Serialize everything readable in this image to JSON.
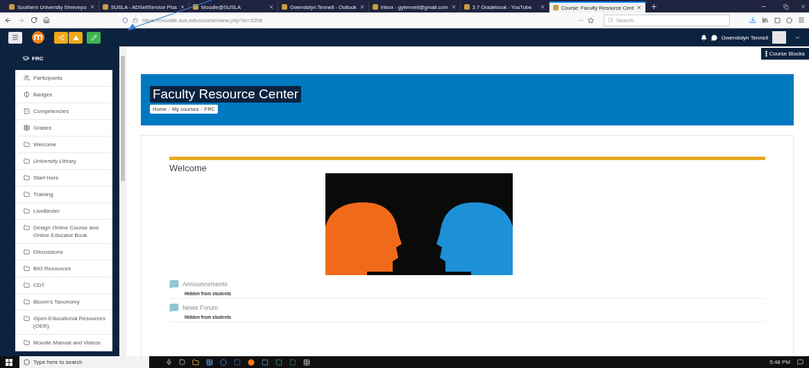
{
  "browser_tabs": [
    {
      "title": "Southern University Shrevepo",
      "selected": false
    },
    {
      "title": "SUSLA - ADSelfService Plus",
      "selected": false
    },
    {
      "title": "Moodle@SUSLA",
      "selected": false
    },
    {
      "title": "Gwendolyn Tennell - Outlook",
      "selected": false
    },
    {
      "title": "Inbox - gytennell@gmail.com",
      "selected": false
    },
    {
      "title": "3 7 Gradebook - YouTube",
      "selected": false
    },
    {
      "title": "Course: Faculty Resource Cent",
      "selected": true
    }
  ],
  "address_bar": {
    "url": "https://moodle.sus.edu/course/view.php?id=3208",
    "more": "···",
    "search_placeholder": "Search"
  },
  "navbar": {
    "user_name": "Gwendolyn Tennell",
    "course_blocks_button": "Course Blocks"
  },
  "sidebar": {
    "title": "FRC",
    "items": [
      {
        "label": "Participants",
        "kind": "people"
      },
      {
        "label": "Badges",
        "kind": "shield"
      },
      {
        "label": "Competencies",
        "kind": "check"
      },
      {
        "label": "Grades",
        "kind": "table"
      },
      {
        "label": "Welcome",
        "kind": "folder"
      },
      {
        "label": "University Library",
        "kind": "folder"
      },
      {
        "label": "Start Here",
        "kind": "folder"
      },
      {
        "label": "Training",
        "kind": "folder"
      },
      {
        "label": "LiveBinder",
        "kind": "folder"
      },
      {
        "label": "Design Online Course and Online Educator Book",
        "kind": "folder"
      },
      {
        "label": "Discussions",
        "kind": "folder"
      },
      {
        "label": "BIO Resources",
        "kind": "folder"
      },
      {
        "label": "CDT",
        "kind": "folder"
      },
      {
        "label": "Bloom's Taxonomy",
        "kind": "folder"
      },
      {
        "label": "Open Educational Resources (OER)",
        "kind": "folder"
      },
      {
        "label": "Moodle Manual and Videos",
        "kind": "folder"
      }
    ]
  },
  "page_header": {
    "title": "Faculty Resource Center",
    "breadcrumb": [
      "Home",
      "My courses",
      "FRC"
    ],
    "separator": "/"
  },
  "section": {
    "title": "Welcome",
    "activities": [
      {
        "name": "Announcements",
        "note": "Hidden from students"
      },
      {
        "name": "News Forum",
        "note": "Hidden from students"
      }
    ]
  },
  "taskbar": {
    "search_placeholder": "Type here to search",
    "time": "5:48 PM"
  }
}
